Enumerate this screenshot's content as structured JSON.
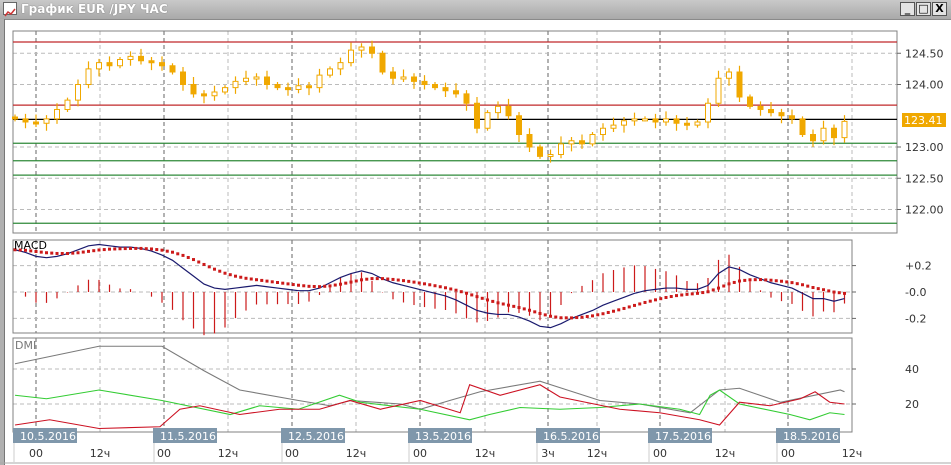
{
  "window": {
    "title": "График EUR /JPY ЧАС",
    "minimize": "_",
    "maximize": "□",
    "close": "X"
  },
  "colors": {
    "candle": "#f0a800",
    "resistance": "#c0282a",
    "support": "#2f8a3a",
    "current": "#000000",
    "macd": "#1a1a6e",
    "signal": "#cc1a1a",
    "adx": "#7a7a7a",
    "plus_di": "#33cc33",
    "minus_di": "#cc1122",
    "date_tag": "#7f97ab"
  },
  "price_panel": {
    "current_price": "123.41",
    "y_ticks": [
      "124.50",
      "124.00",
      "123.00",
      "122.50",
      "122.00"
    ],
    "y_tick_values": [
      124.5,
      124.0,
      123.0,
      122.5,
      122.0
    ],
    "resistance_levels": [
      124.68,
      123.67
    ],
    "support_levels": [
      123.06,
      122.78,
      122.55,
      121.78
    ],
    "closes": [
      123.45,
      123.4,
      123.38,
      123.45,
      123.6,
      123.75,
      124.0,
      124.25,
      124.35,
      124.3,
      124.4,
      124.45,
      124.38,
      124.35,
      124.3,
      124.2,
      124.0,
      123.85,
      123.82,
      123.88,
      123.95,
      124.05,
      124.1,
      124.12,
      124.0,
      123.95,
      123.92,
      123.98,
      123.95,
      124.15,
      124.25,
      124.35,
      124.55,
      124.6,
      124.5,
      124.2,
      124.1,
      124.12,
      124.05,
      124.0,
      123.95,
      123.9,
      123.85,
      123.7,
      123.3,
      123.55,
      123.65,
      123.5,
      123.2,
      123.0,
      122.85,
      122.88,
      123.05,
      123.1,
      123.05,
      123.2,
      123.3,
      123.35,
      123.42,
      123.45,
      123.45,
      123.4,
      123.45,
      123.38,
      123.35,
      123.4,
      123.7,
      124.1,
      124.2,
      123.8,
      123.65,
      123.6,
      123.55,
      123.5,
      123.45,
      123.2,
      123.1,
      123.3,
      123.15,
      123.41
    ]
  },
  "macd_panel": {
    "label": "MACD",
    "y_ticks": [
      "+0.2",
      "-0.0",
      "-0.2"
    ],
    "y_tick_values": [
      0.2,
      0.0,
      -0.2
    ],
    "signal_period": 9,
    "macd": [
      0.32,
      0.3,
      0.27,
      0.26,
      0.27,
      0.29,
      0.32,
      0.35,
      0.36,
      0.35,
      0.34,
      0.34,
      0.33,
      0.31,
      0.28,
      0.24,
      0.18,
      0.12,
      0.06,
      0.03,
      0.02,
      0.03,
      0.04,
      0.05,
      0.04,
      0.03,
      0.02,
      0.01,
      0.01,
      0.03,
      0.07,
      0.11,
      0.14,
      0.16,
      0.14,
      0.1,
      0.07,
      0.05,
      0.03,
      0.01,
      -0.01,
      -0.03,
      -0.06,
      -0.1,
      -0.14,
      -0.16,
      -0.17,
      -0.17,
      -0.19,
      -0.22,
      -0.26,
      -0.27,
      -0.24,
      -0.2,
      -0.17,
      -0.14,
      -0.1,
      -0.07,
      -0.04,
      -0.01,
      0.01,
      0.02,
      0.03,
      0.03,
      0.02,
      0.02,
      0.05,
      0.14,
      0.19,
      0.17,
      0.13,
      0.1,
      0.07,
      0.05,
      0.03,
      -0.01,
      -0.05,
      -0.05,
      -0.07,
      -0.05
    ]
  },
  "dmi_panel": {
    "label": "DMI",
    "y_ticks": [
      "40",
      "20"
    ],
    "y_tick_values": [
      40,
      20
    ],
    "adx": [
      [
        0,
        43
      ],
      [
        8,
        53
      ],
      [
        14,
        53
      ],
      [
        18,
        39
      ],
      [
        21.4,
        28
      ],
      [
        27,
        22
      ],
      [
        30,
        19
      ],
      [
        32,
        22
      ],
      [
        36.7,
        20
      ],
      [
        38.6,
        17
      ],
      [
        41.4,
        22
      ],
      [
        44.3,
        27
      ],
      [
        50,
        33
      ],
      [
        55.7,
        22
      ],
      [
        59.5,
        20
      ],
      [
        64.3,
        15
      ],
      [
        67.1,
        28
      ],
      [
        69,
        29
      ],
      [
        72.9,
        21
      ],
      [
        78.6,
        28
      ],
      [
        79,
        27
      ]
    ],
    "plus_di": [
      [
        0,
        25
      ],
      [
        3,
        23
      ],
      [
        8,
        28
      ],
      [
        14,
        22
      ],
      [
        20.5,
        14
      ],
      [
        23.3,
        19
      ],
      [
        27,
        17
      ],
      [
        30.9,
        25
      ],
      [
        32.9,
        21
      ],
      [
        38.6,
        17
      ],
      [
        43.3,
        11
      ],
      [
        45.2,
        14
      ],
      [
        48.1,
        18
      ],
      [
        51.9,
        17
      ],
      [
        55.7,
        18
      ],
      [
        59.5,
        20
      ],
      [
        63.3,
        17
      ],
      [
        65.2,
        14
      ],
      [
        66.2,
        25
      ],
      [
        67.1,
        28
      ],
      [
        69,
        20
      ],
      [
        73.8,
        14
      ],
      [
        75.7,
        11
      ],
      [
        77.6,
        15
      ],
      [
        79,
        14
      ]
    ],
    "minus_di": [
      [
        0,
        8
      ],
      [
        3.3,
        11
      ],
      [
        8,
        6
      ],
      [
        13.8,
        7
      ],
      [
        15.7,
        17
      ],
      [
        17.6,
        19
      ],
      [
        21.4,
        14
      ],
      [
        25.2,
        17
      ],
      [
        29,
        17
      ],
      [
        31.9,
        22
      ],
      [
        34.8,
        17
      ],
      [
        38.6,
        22
      ],
      [
        42.4,
        15
      ],
      [
        43.3,
        31
      ],
      [
        46.2,
        25
      ],
      [
        50,
        31
      ],
      [
        51.9,
        24
      ],
      [
        57.6,
        17
      ],
      [
        61.4,
        15
      ],
      [
        65.2,
        11
      ],
      [
        67.1,
        8
      ],
      [
        69,
        21
      ],
      [
        71.9,
        19
      ],
      [
        74.8,
        23
      ],
      [
        76.2,
        27
      ],
      [
        77.6,
        21
      ],
      [
        79,
        20
      ]
    ]
  },
  "time_axis": {
    "dates": [
      "10.5.2016",
      "11.5.2016",
      "12.5.2016",
      "13.5.2016",
      "16.5.2016",
      "17.5.2016",
      "18.5.2016"
    ],
    "hours": [
      "00",
      "12ч",
      "00",
      "12ч",
      "00",
      "12ч",
      "00",
      "12ч",
      "3ч",
      "12ч",
      "00",
      "12ч",
      "00",
      "12ч"
    ]
  }
}
